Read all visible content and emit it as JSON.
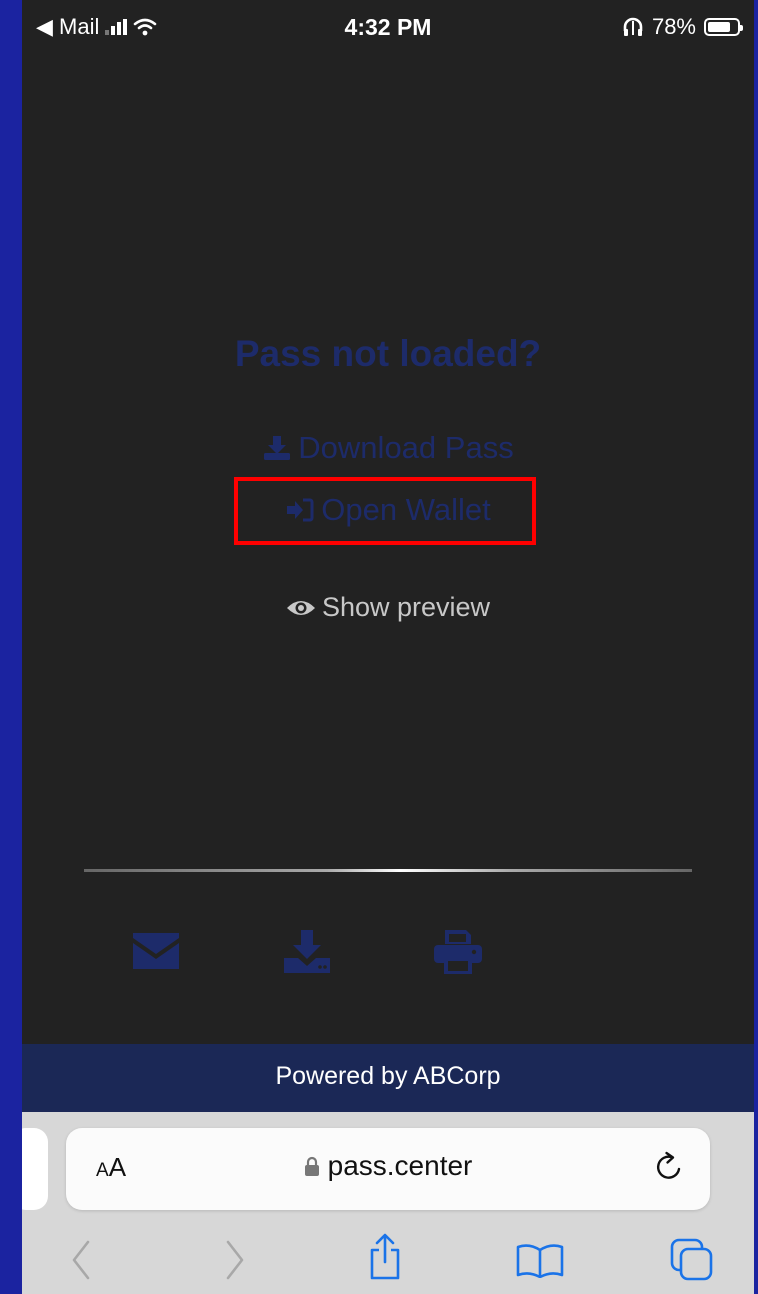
{
  "status_bar": {
    "back_label": "◀ Mail",
    "time": "4:32 PM",
    "battery": "78%",
    "battery_level": 0.78
  },
  "page": {
    "heading": "Pass not loaded?",
    "download_link": "Download Pass",
    "wallet_link": "Open Wallet",
    "preview_link": "Show preview",
    "footer": "Powered by ABCorp"
  },
  "browser": {
    "text_size_label_small": "A",
    "text_size_label_large": "A",
    "url": "pass.center"
  },
  "colors": {
    "link": "#1d2b6a",
    "highlight": "#ff0000",
    "footer_bg": "#1b2856",
    "toolbar_accent": "#1a73e8"
  }
}
